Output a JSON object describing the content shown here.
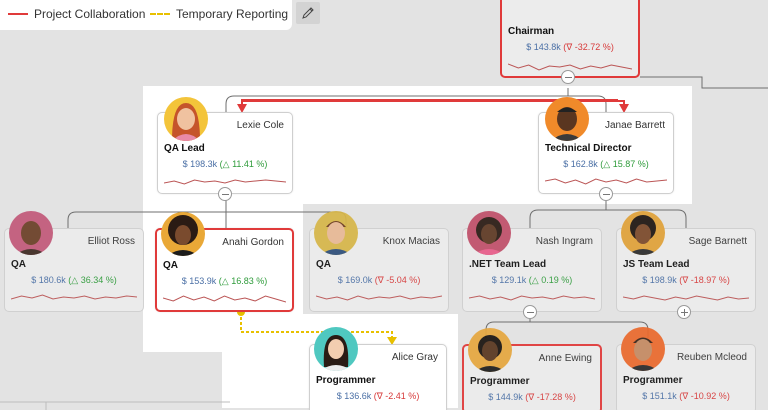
{
  "legend": {
    "items": [
      {
        "label": "Project Collaboration",
        "style": "solid",
        "color": "#e03a3a"
      },
      {
        "label": "Temporary Reporting",
        "style": "dashed",
        "color": "#e8c000"
      }
    ],
    "edit_icon": "pencil-icon"
  },
  "colors": {
    "positive": "#2e9b3a",
    "negative": "#d73a3a",
    "amount": "#4a6fa5",
    "highlight_border": "#e03a3a",
    "temp_link": "#e8c000"
  },
  "nodes": {
    "chairman": {
      "name": "",
      "title": "Chairman",
      "amount": "$ 143.8k",
      "delta_icon": "∇",
      "delta": "-32.72 %",
      "trend": "down"
    },
    "lexie": {
      "name": "Lexie Cole",
      "title": "QA Lead",
      "amount": "$ 198.3k",
      "delta_icon": "△",
      "delta": "11.41 %",
      "trend": "up"
    },
    "janae": {
      "name": "Janae Barrett",
      "title": "Technical Director",
      "amount": "$ 162.8k",
      "delta_icon": "△",
      "delta": "15.87 %",
      "trend": "up"
    },
    "elliot": {
      "name": "Elliot Ross",
      "title": "QA",
      "amount": "$ 180.6k",
      "delta_icon": "△",
      "delta": "36.34 %",
      "trend": "up"
    },
    "anahi": {
      "name": "Anahi Gordon",
      "title": "QA",
      "amount": "$ 153.9k",
      "delta_icon": "△",
      "delta": "16.83 %",
      "trend": "up"
    },
    "knox": {
      "name": "Knox Macias",
      "title": "QA",
      "amount": "$ 169.0k",
      "delta_icon": "∇",
      "delta": "-5.04 %",
      "trend": "down"
    },
    "nash": {
      "name": "Nash Ingram",
      "title": ".NET Team Lead",
      "amount": "$ 129.1k",
      "delta_icon": "△",
      "delta": "0.19 %",
      "trend": "up"
    },
    "sage": {
      "name": "Sage Barnett",
      "title": "JS Team Lead",
      "amount": "$ 198.9k",
      "delta_icon": "∇",
      "delta": "-18.97 %",
      "trend": "down"
    },
    "alice": {
      "name": "Alice Gray",
      "title": "Programmer",
      "amount": "$ 136.6k",
      "delta_icon": "∇",
      "delta": "-2.41 %",
      "trend": "down"
    },
    "anne": {
      "name": "Anne Ewing",
      "title": "Programmer",
      "amount": "$ 144.9k",
      "delta_icon": "∇",
      "delta": "-17.28 %",
      "trend": "down"
    },
    "reuben": {
      "name": "Reuben Mcleod",
      "title": "Programmer",
      "amount": "$ 151.1k",
      "delta_icon": "∇",
      "delta": "-10.92 %",
      "trend": "down"
    }
  }
}
